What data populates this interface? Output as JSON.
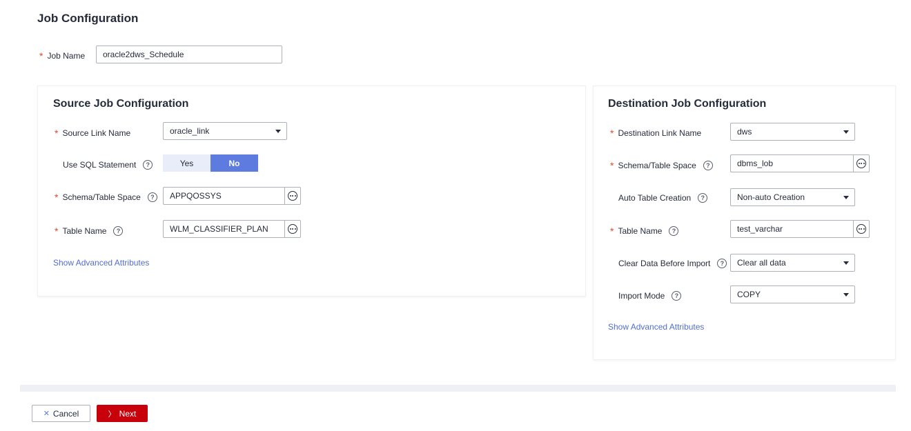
{
  "page_title": "Job Configuration",
  "job_name": {
    "label": "Job Name",
    "value": "oracle2dws_Schedule"
  },
  "source": {
    "title": "Source Job Configuration",
    "link_name": {
      "label": "Source Link Name",
      "value": "oracle_link"
    },
    "use_sql": {
      "label": "Use SQL Statement",
      "yes": "Yes",
      "no": "No",
      "selected": "No"
    },
    "schema": {
      "label": "Schema/Table Space",
      "value": "APPQOSSYS"
    },
    "table": {
      "label": "Table Name",
      "value": "WLM_CLASSIFIER_PLAN"
    },
    "advanced_link": "Show Advanced Attributes"
  },
  "destination": {
    "title": "Destination Job Configuration",
    "link_name": {
      "label": "Destination Link Name",
      "value": "dws"
    },
    "schema": {
      "label": "Schema/Table Space",
      "value": "dbms_lob"
    },
    "auto_table": {
      "label": "Auto Table Creation",
      "value": "Non-auto Creation"
    },
    "table": {
      "label": "Table Name",
      "value": "test_varchar"
    },
    "clear_data": {
      "label": "Clear Data Before Import",
      "value": "Clear all data"
    },
    "import_mode": {
      "label": "Import Mode",
      "value": "COPY"
    },
    "advanced_link": "Show Advanced Attributes"
  },
  "footer": {
    "cancel": "Cancel",
    "next": "Next"
  },
  "colors": {
    "required": "#e5472d",
    "accent": "#5e7ce0",
    "primary_button": "#c7000b",
    "link": "#526ecc"
  }
}
